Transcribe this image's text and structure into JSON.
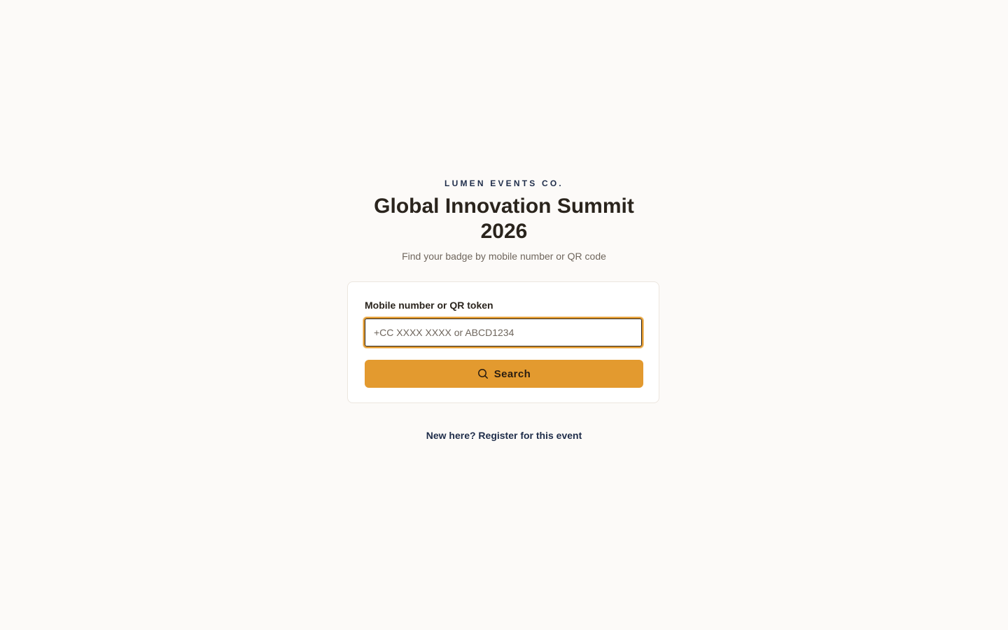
{
  "header": {
    "org_name": "LUMEN EVENTS CO.",
    "event_title": "Global Innovation Summit 2026",
    "subtitle": "Find your badge by mobile number or QR code"
  },
  "lookup_form": {
    "field_label": "Mobile number or QR token",
    "input_value": "",
    "input_placeholder": "+CC XXXX XXXX or ABCD1234",
    "search_label": "Search",
    "search_icon": "search-icon"
  },
  "footer": {
    "register_link": "New here? Register for this event"
  },
  "colors": {
    "background": "#fcfaf8",
    "accent": "#e39a2f",
    "link": "#1f2d4a",
    "text_muted": "#6f665d"
  }
}
